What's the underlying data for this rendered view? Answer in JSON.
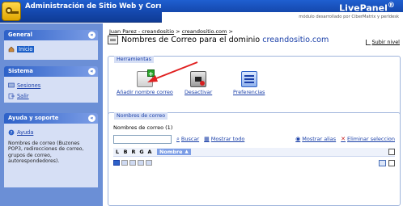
{
  "header": {
    "title": "Administración de Sitio Web y Correo Electr",
    "brand": "LivePanel",
    "brand_mark": "®",
    "subtitle": "módulo desarrollado por CiberMatrix y perldesk"
  },
  "sidebar": {
    "sections": [
      {
        "title": "General",
        "items": [
          {
            "label": "Inicio",
            "icon": "home-icon"
          }
        ]
      },
      {
        "title": "Sistema",
        "items": [
          {
            "label": "Sesiones",
            "icon": "sessions-icon"
          },
          {
            "label": "Salir",
            "icon": "logout-icon"
          }
        ]
      },
      {
        "title": "Ayuda y soporte",
        "items": [
          {
            "label": "Ayuda",
            "icon": "help-icon"
          }
        ],
        "text": "Nombres de correo (Buzones POP3, redirecciones de correo, grupos de correo, autorespondedores)."
      }
    ],
    "collapse_glyph": "«"
  },
  "breadcrumb": {
    "items": [
      "Juan Parez - creandositio",
      "creandositio.com"
    ],
    "separator": ">"
  },
  "page": {
    "title_prefix": "Nombres de Correo para el dominio",
    "domain": "creandositio.com",
    "up_label": "Subir nivel"
  },
  "tools": {
    "legend": "Herramientas",
    "items": [
      {
        "label": "Añadir nombre correo",
        "icon": "add-mail-name-icon"
      },
      {
        "label": "Desactivar",
        "icon": "deactivate-icon"
      },
      {
        "label": "Preferencias",
        "icon": "preferences-icon"
      }
    ]
  },
  "names": {
    "legend": "Nombres de correo",
    "count_label": "Nombres de correo (1)",
    "search_value": "",
    "search_label": "Buscar",
    "show_all_label": "Mostrar todo",
    "show_alias_label": "Mostrar alias",
    "delete_label": "Eliminar seleccion",
    "columns": [
      "L",
      "B",
      "R",
      "G",
      "A"
    ],
    "name_column": "Nombre",
    "sort_glyph": "▲"
  },
  "colors": {
    "header_blue": "#1548ad",
    "sidebar_blue": "#6b8fd6",
    "link_blue": "#1a3fa8",
    "arrow_red": "#e02020"
  }
}
